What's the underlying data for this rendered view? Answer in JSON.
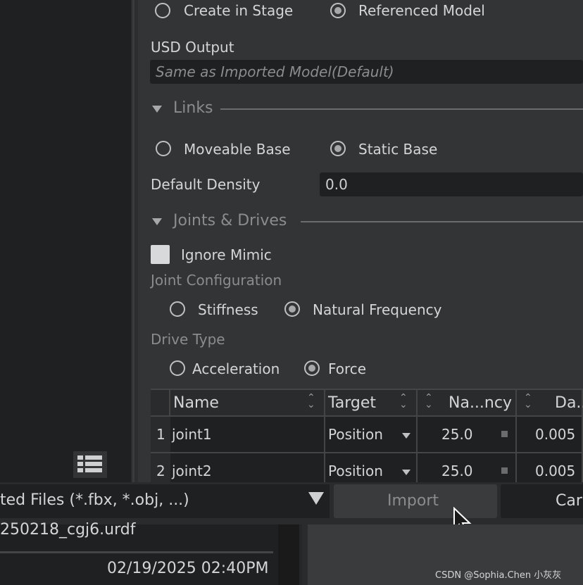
{
  "import_mode": {
    "option1": "Create in Stage",
    "option2": "Referenced Model",
    "selected": "Referenced Model"
  },
  "usd_output": {
    "label": "USD Output",
    "placeholder": "Same as Imported Model(Default)"
  },
  "links": {
    "title": "Links",
    "option1": "Moveable Base",
    "option2": "Static Base",
    "selected": "Static Base",
    "density_label": "Default Density",
    "density_value": "0.0"
  },
  "joints": {
    "title": "Joints & Drives",
    "ignore_mimic": "Ignore Mimic",
    "joint_config_label": "Joint Configuration",
    "config_opt1": "Stiffness",
    "config_opt2": "Natural Frequency",
    "drive_type_label": "Drive Type",
    "drive_opt1": "Acceleration",
    "drive_opt2": "Force"
  },
  "table": {
    "headers": [
      "Name",
      "Target",
      "Na...ncy",
      "Da..."
    ],
    "rows": [
      {
        "num": "1",
        "name": "joint1",
        "target": "Position",
        "freq": "25.0",
        "damp": "0.005"
      },
      {
        "num": "2",
        "name": "joint2",
        "target": "Position",
        "freq": "25.0",
        "damp": "0.005"
      }
    ]
  },
  "bottom": {
    "filter": "ted Files (*.fbx, *.obj, ...)",
    "import": "Import",
    "cancel": "Car"
  },
  "file": {
    "name": "250218_cgj6.urdf",
    "date": "02/19/2025 02:40PM"
  },
  "watermark": "CSDN @Sophia.Chen 小灰灰"
}
